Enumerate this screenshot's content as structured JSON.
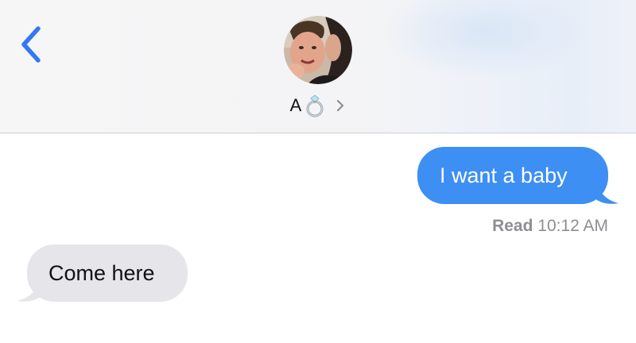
{
  "header": {
    "contact_name": "A",
    "contact_emoji": "ring-icon"
  },
  "messages": [
    {
      "direction": "sent",
      "text": "I want a baby"
    },
    {
      "direction": "received",
      "text": "Come here"
    }
  ],
  "read_receipt": {
    "label": "Read",
    "time": "10:12 AM"
  },
  "colors": {
    "sent_bubble": "#3d8ff4",
    "received_bubble": "#e6e5ea",
    "accent": "#3478f6",
    "receipt_text": "#8e8e93"
  }
}
